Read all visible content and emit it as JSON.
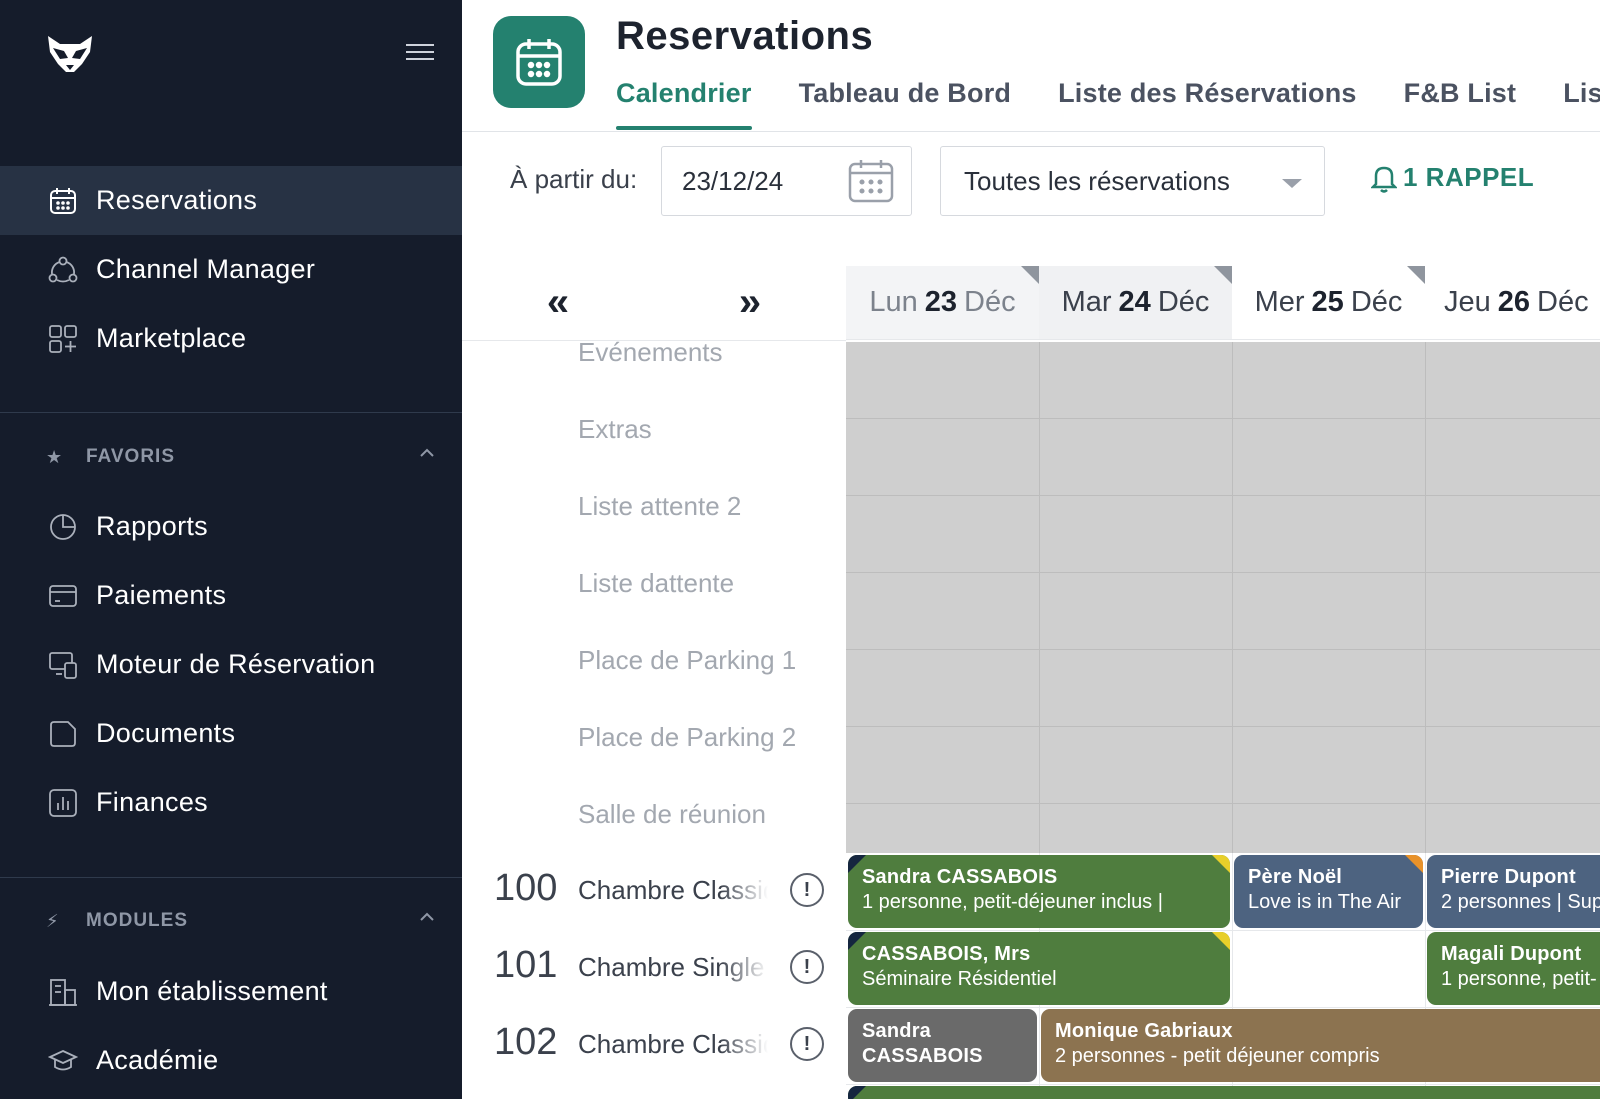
{
  "sidebar": {
    "main_items": [
      {
        "label": "Reservations",
        "icon": "calendar-icon"
      },
      {
        "label": "Channel Manager",
        "icon": "network-icon"
      },
      {
        "label": "Marketplace",
        "icon": "grid-plus-icon"
      }
    ],
    "favorites_title": "FAVORIS",
    "favorites": [
      {
        "label": "Rapports",
        "icon": "pie-chart-icon"
      },
      {
        "label": "Paiements",
        "icon": "credit-card-icon"
      },
      {
        "label": "Moteur de Réservation",
        "icon": "devices-icon"
      },
      {
        "label": "Documents",
        "icon": "document-icon"
      },
      {
        "label": "Finances",
        "icon": "bar-chart-icon"
      }
    ],
    "modules_title": "MODULES",
    "modules": [
      {
        "label": "Mon établissement",
        "icon": "building-icon"
      },
      {
        "label": "Académie",
        "icon": "graduation-cap-icon"
      }
    ]
  },
  "header": {
    "title": "Reservations",
    "tabs": [
      "Calendrier",
      "Tableau de Bord",
      "Liste des Réservations",
      "F&B List",
      "Liste"
    ]
  },
  "toolbar": {
    "from_label": "À partir du:",
    "date_value": "23/12/24",
    "filter_value": "Toutes les réservations",
    "reminder_label": "1 RAPPEL"
  },
  "calendar": {
    "prev_label": "«",
    "next_label": "»",
    "days": [
      {
        "dow": "Lun",
        "num": "23",
        "mon": "Déc"
      },
      {
        "dow": "Mar",
        "num": "24",
        "mon": "Déc"
      },
      {
        "dow": "Mer",
        "num": "25",
        "mon": "Déc"
      },
      {
        "dow": "Jeu",
        "num": "26",
        "mon": "Déc"
      }
    ],
    "resources": [
      "Evénements",
      "Extras",
      "Liste attente 2",
      "Liste dattente",
      "Place de Parking 1",
      "Place de Parking 2",
      "Salle de réunion"
    ],
    "rooms": [
      {
        "num": "100",
        "name": "Chambre Classique"
      },
      {
        "num": "101",
        "name": "Chambre Single"
      },
      {
        "num": "102",
        "name": "Chambre Classique"
      }
    ],
    "bookings": [
      {
        "name": "Sandra CASSABOIS",
        "desc": "1 personne, petit-déjeuner inclus |"
      },
      {
        "name": "Père Noël",
        "desc": "Love is in The Air"
      },
      {
        "name": "Pierre Dupont",
        "desc": "2 personnes | Sup"
      },
      {
        "name": "CASSABOIS, Mrs",
        "desc": "Séminaire Résidentiel"
      },
      {
        "name": "Magali Dupont",
        "desc": "1 personne, petit-"
      },
      {
        "name": "Sandra CASSABOIS",
        "desc": ""
      },
      {
        "name": "Monique Gabriaux",
        "desc": "2 personnes - petit déjeuner compris"
      }
    ]
  },
  "colors": {
    "sidebar_bg": "#151c2b",
    "accent": "#24816f",
    "booking_green": "#4f7d3e",
    "booking_blue": "#4d6380",
    "booking_grey": "#6a6a6a",
    "booking_tan": "#8c7350"
  }
}
